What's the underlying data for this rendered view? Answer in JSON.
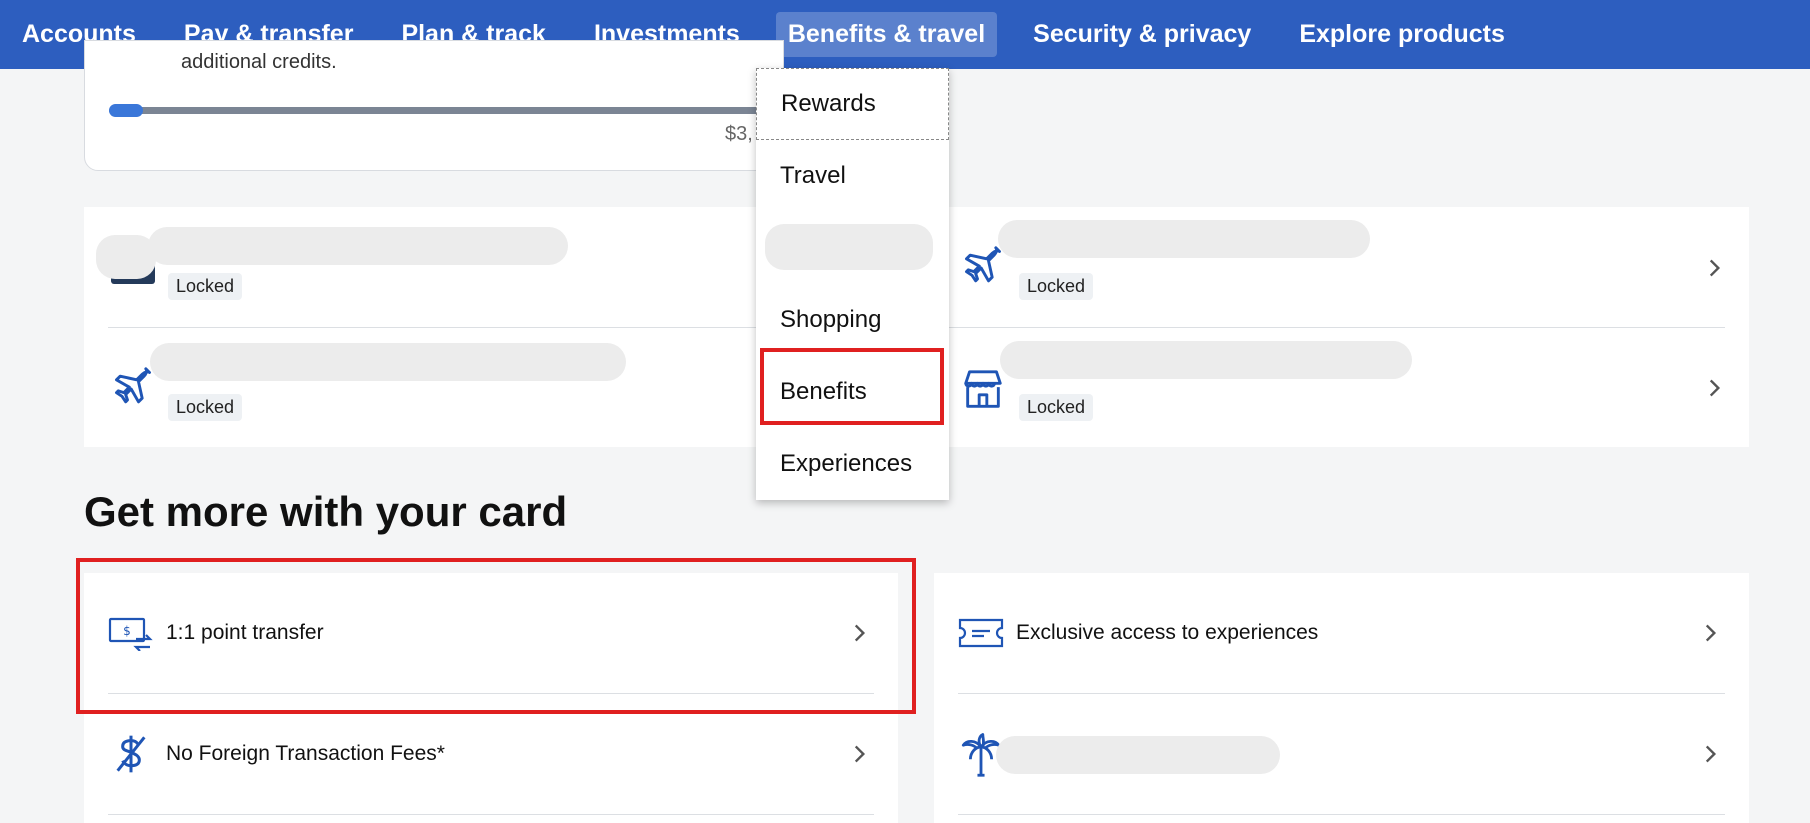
{
  "nav": {
    "items": [
      {
        "label": "Accounts"
      },
      {
        "label": "Pay & transfer"
      },
      {
        "label": "Plan & track"
      },
      {
        "label": "Investments"
      },
      {
        "label": "Benefits & travel",
        "active": true
      },
      {
        "label": "Security & privacy"
      },
      {
        "label": "Explore products"
      }
    ]
  },
  "progress": {
    "clipped_text": "additional credits.",
    "amount": "$3,",
    "fraction": 0.04
  },
  "locked": {
    "badge": "Locked",
    "items": [
      {
        "icon": "card-icon"
      },
      {
        "icon": "airplane-icon"
      },
      {
        "icon": "airplane-icon"
      },
      {
        "icon": "store-icon"
      }
    ]
  },
  "dropdown": {
    "items": [
      {
        "label": "Rewards"
      },
      {
        "label": "Travel"
      },
      {
        "label": ""
      },
      {
        "label": "Shopping"
      },
      {
        "label": "Benefits"
      },
      {
        "label": "Experiences"
      }
    ]
  },
  "section": {
    "title": "Get more with your card"
  },
  "get_more": {
    "left": [
      {
        "label": "1:1 point transfer",
        "icon": "point-transfer-icon"
      },
      {
        "label": "No Foreign Transaction Fees*",
        "icon": "no-dollar-icon"
      }
    ],
    "right": [
      {
        "label": "Exclusive access to experiences",
        "icon": "ticket-icon"
      },
      {
        "label": "",
        "icon": "palm-tree-icon"
      }
    ]
  },
  "colors": {
    "nav_bg": "#2d5ebf",
    "accent": "#1f55b5",
    "highlight": "#e02020"
  }
}
